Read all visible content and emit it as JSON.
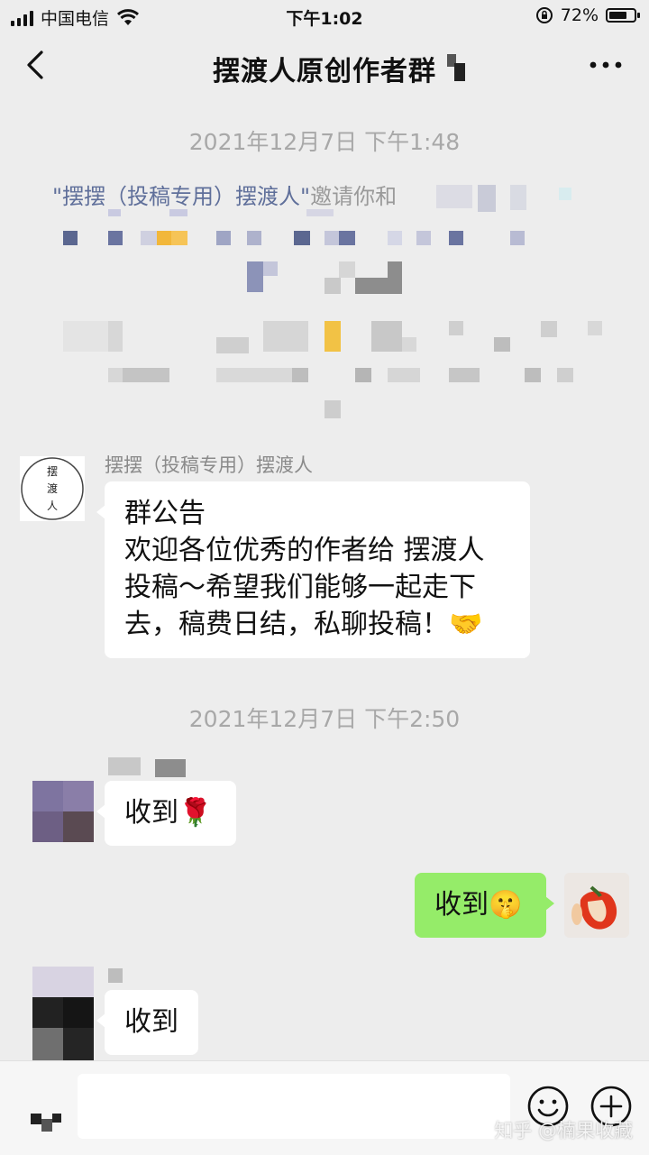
{
  "status_bar": {
    "carrier": "中国电信",
    "time": "下午1:02",
    "battery_percent": "72%",
    "battery_level": 0.72
  },
  "nav": {
    "title": "摆渡人原创作者群"
  },
  "chat": {
    "timestamp_1": "2021年12月7日 下午1:48",
    "system_message": {
      "inviter": "\"摆摆（投稿专用）摆渡人\"",
      "text": "邀请你和"
    },
    "announcement": {
      "sender": "摆摆（投稿专用）摆渡人",
      "avatar_text": "摆渡人",
      "lines": [
        "群公告",
        "欢迎各位优秀的作者给 摆渡人",
        "投稿～希望我们能够一起走下",
        "去，稿费日结，私聊投稿！🤝"
      ]
    },
    "timestamp_2": "2021年12月7日 下午2:50",
    "messages": [
      {
        "side": "left",
        "text": "收到🌹"
      },
      {
        "side": "right",
        "text": "收到🤫"
      },
      {
        "side": "left",
        "text": "收到"
      }
    ]
  },
  "watermark": "知乎 @楠果收藏",
  "icons": {
    "back": "chevron-left-icon",
    "more": "more-dots-icon",
    "emoji": "emoji-icon",
    "add": "plus-circle-icon"
  },
  "colors": {
    "background": "#ededed",
    "bubble_mine": "#95ec69",
    "bubble_other": "#ffffff",
    "link": "#5f6f9a"
  }
}
